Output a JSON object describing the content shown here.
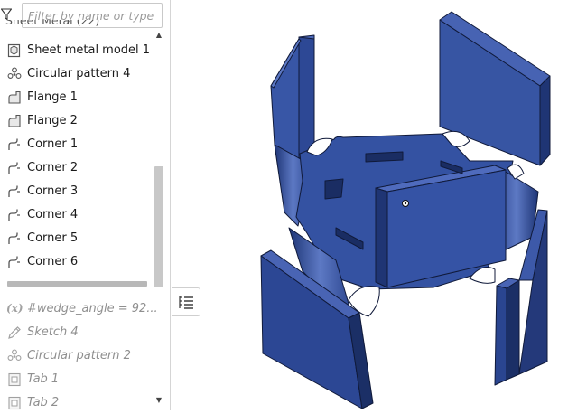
{
  "feature_list": {
    "filter": {
      "placeholder": "Filter by name or type",
      "value": ""
    },
    "folder_header": "Sheet Metal (22)",
    "features": [
      {
        "label": "Sheet metal model 1",
        "icon": "sheet-metal-model-icon",
        "rolled_back": false
      },
      {
        "label": "Circular pattern 4",
        "icon": "circular-pattern-icon",
        "rolled_back": false
      },
      {
        "label": "Flange 1",
        "icon": "flange-icon",
        "rolled_back": false
      },
      {
        "label": "Flange 2",
        "icon": "flange-icon",
        "rolled_back": false
      },
      {
        "label": "Corner 1",
        "icon": "corner-icon",
        "rolled_back": false
      },
      {
        "label": "Corner 2",
        "icon": "corner-icon",
        "rolled_back": false
      },
      {
        "label": "Corner 3",
        "icon": "corner-icon",
        "rolled_back": false
      },
      {
        "label": "Corner 4",
        "icon": "corner-icon",
        "rolled_back": false
      },
      {
        "label": "Corner 5",
        "icon": "corner-icon",
        "rolled_back": false
      },
      {
        "label": "Corner 6",
        "icon": "corner-icon",
        "rolled_back": false
      }
    ],
    "rolled_back_features": [
      {
        "label": "#wedge_angle = 92...",
        "icon": "variable-icon",
        "rolled_back": true
      },
      {
        "label": "Sketch 4",
        "icon": "sketch-icon",
        "rolled_back": true
      },
      {
        "label": "Circular pattern 2",
        "icon": "circular-pattern-icon",
        "rolled_back": true
      },
      {
        "label": "Tab 1",
        "icon": "tab-icon",
        "rolled_back": true
      },
      {
        "label": "Tab 2",
        "icon": "tab-icon",
        "rolled_back": true
      }
    ],
    "variable_prefix": "(x)"
  },
  "colors": {
    "part_face_light": "#3b59a6",
    "part_face_dark": "#253f85",
    "part_edge": "#101a3a",
    "panel_border": "#d5d5d5"
  }
}
